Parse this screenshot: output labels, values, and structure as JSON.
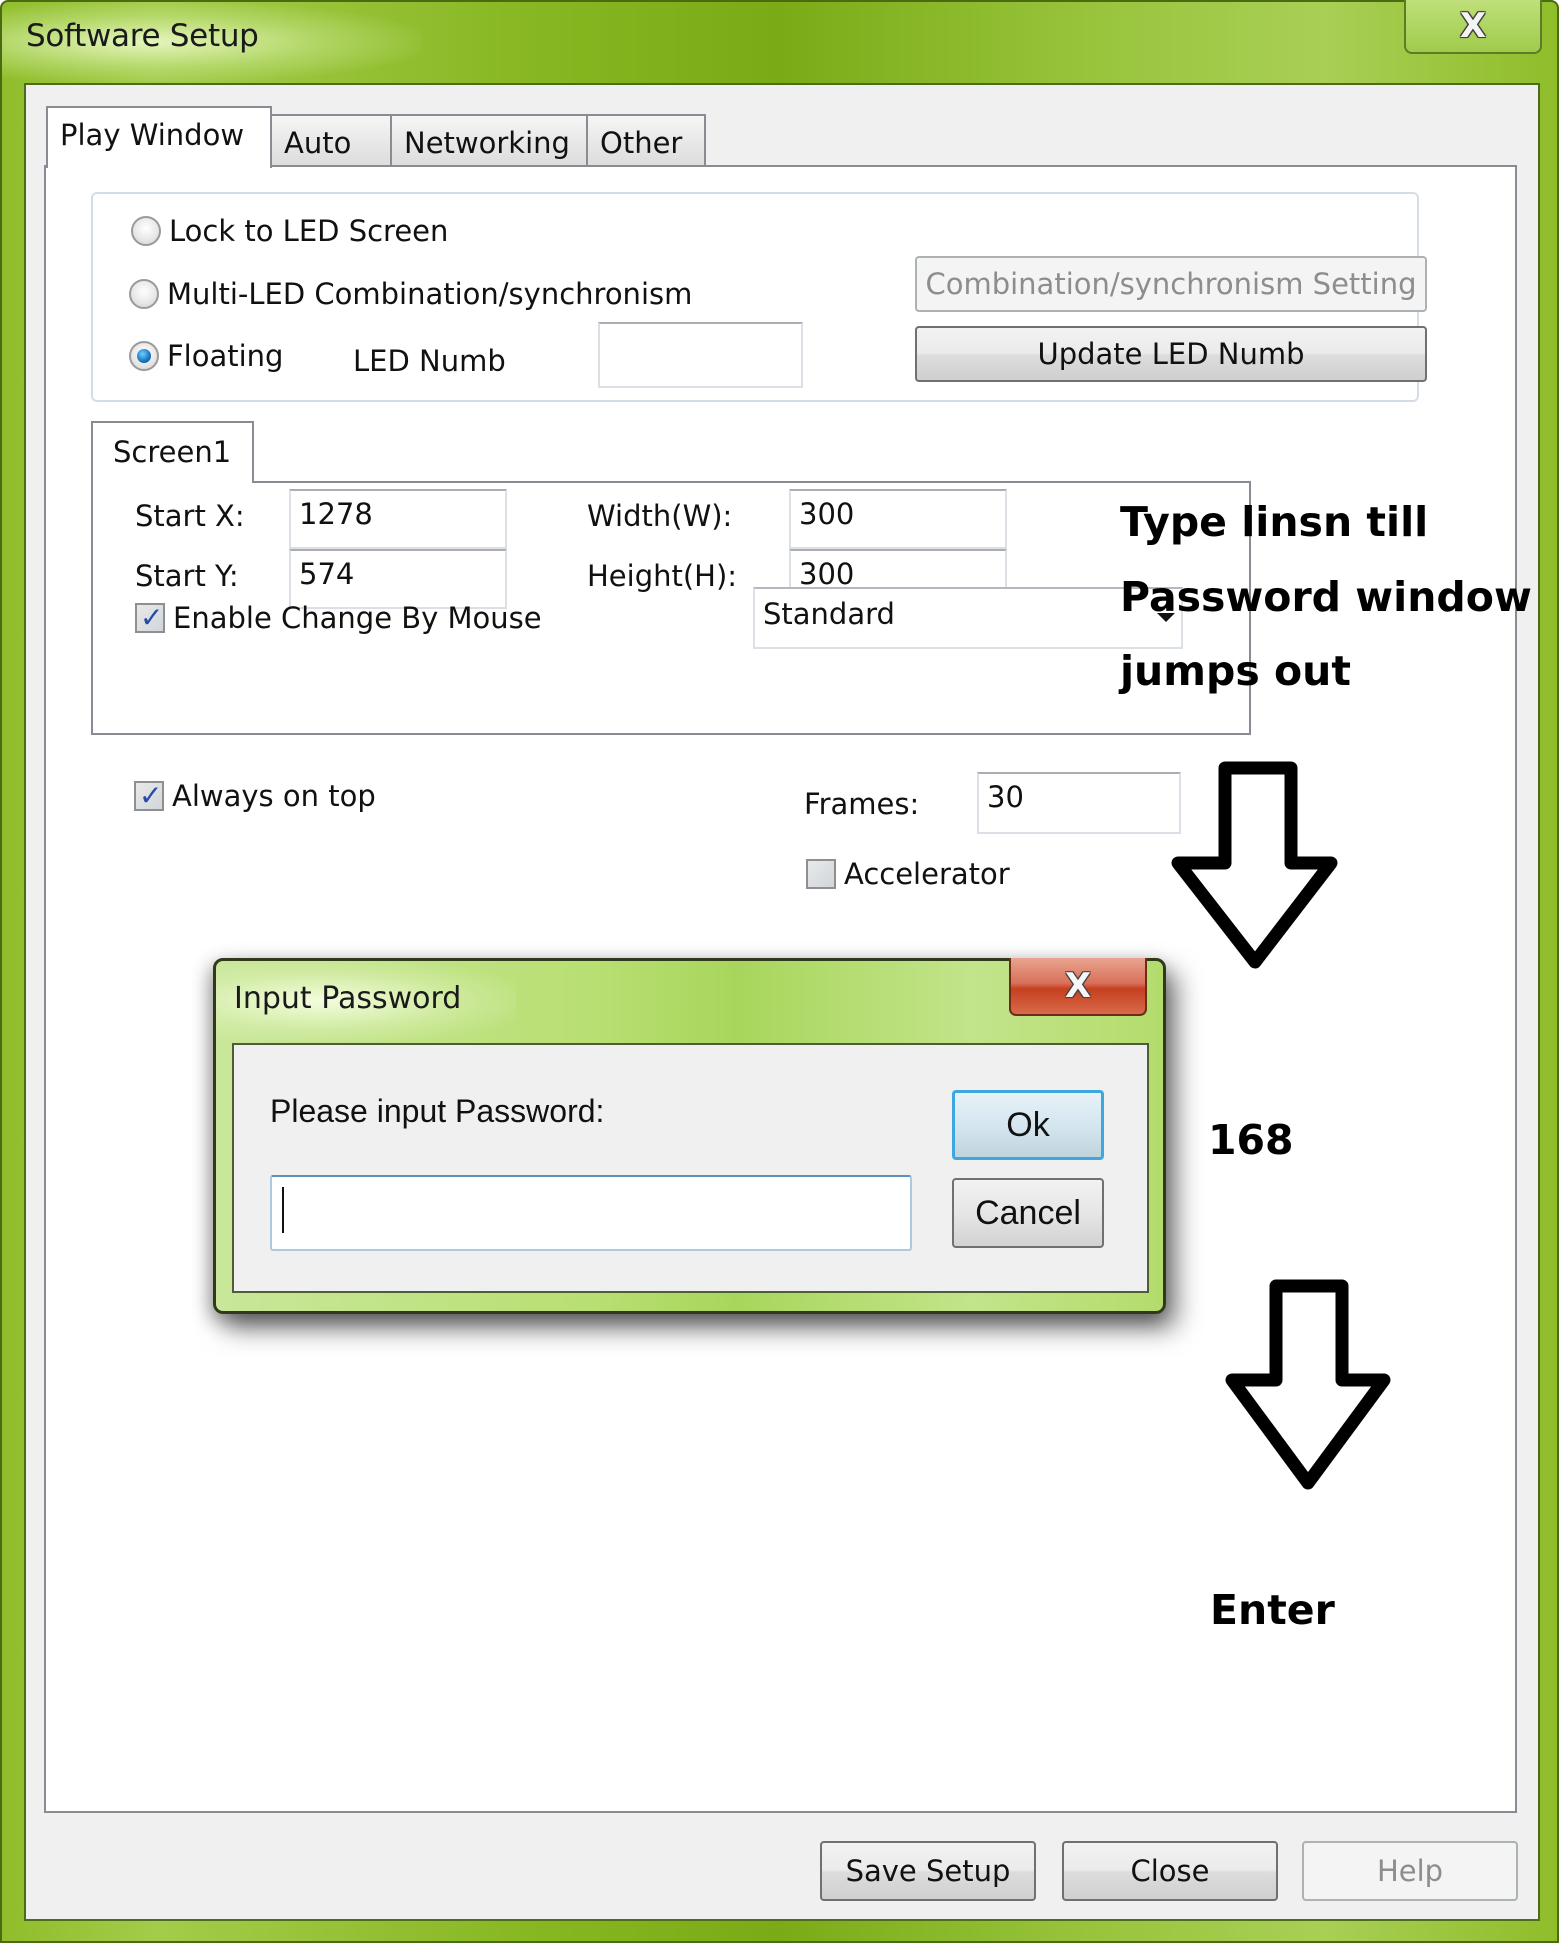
{
  "window": {
    "title": "Software Setup",
    "close_icon": "close-icon",
    "close_glyph": "X"
  },
  "tabs": [
    {
      "label": "Play Window",
      "active": true
    },
    {
      "label": "Auto",
      "active": false
    },
    {
      "label": "Networking",
      "active": false
    },
    {
      "label": "Other",
      "active": false
    }
  ],
  "play_mode": {
    "options": [
      {
        "label": "Lock to LED Screen",
        "checked": false
      },
      {
        "label": "Multi-LED Combination/synchronism",
        "checked": false
      },
      {
        "label": "Floating",
        "checked": true
      }
    ],
    "led_numb_label": "LED Numb",
    "led_numb_value": "",
    "combination_button": "Combination/synchronism Setting",
    "combination_button_enabled": false,
    "update_button": "Update LED Numb"
  },
  "screen": {
    "tab_label": "Screen1",
    "start_x_label": "Start X:",
    "start_x": "1278",
    "start_y_label": "Start Y:",
    "start_y": "574",
    "width_label": "Width(W):",
    "width": "300",
    "height_label": "Height(H):",
    "height": "300",
    "enable_mouse_label": "Enable Change By Mouse",
    "enable_mouse_checked": true,
    "mode_selected": "Standard"
  },
  "options": {
    "always_on_top_label": "Always on top",
    "always_on_top_checked": true,
    "frames_label": "Frames:",
    "frames_value": "30",
    "accelerator_label": "Accelerator",
    "accelerator_checked": false
  },
  "annotations": {
    "step1_line1": "Type linsn till",
    "step1_line2": "Password window",
    "step1_line3": "jumps out",
    "step2": "168",
    "step3": "Enter"
  },
  "password_dialog": {
    "title": "Input Password",
    "close_glyph": "X",
    "prompt": "Please input Password:",
    "value": "",
    "ok_label": "Ok",
    "cancel_label": "Cancel"
  },
  "footer": {
    "save_label": "Save Setup",
    "close_label": "Close",
    "help_label": "Help",
    "help_enabled": false
  },
  "colors": {
    "frame_green": "#8fbd2a",
    "dialog_green": "#b8df72",
    "close_red": "#c5401f",
    "focus_blue": "#3fa6e0"
  }
}
